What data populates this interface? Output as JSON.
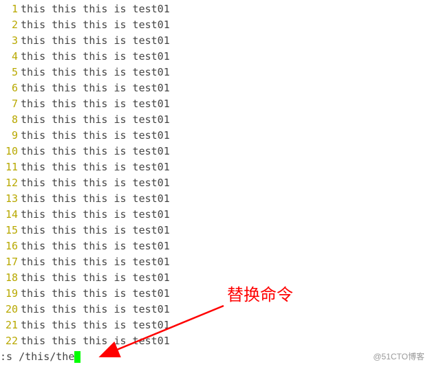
{
  "editor": {
    "lines": [
      {
        "n": "1",
        "t": "this this this is test01"
      },
      {
        "n": "2",
        "t": "this this this is test01"
      },
      {
        "n": "3",
        "t": "this this this is test01"
      },
      {
        "n": "4",
        "t": "this this this is test01"
      },
      {
        "n": "5",
        "t": "this this this is test01"
      },
      {
        "n": "6",
        "t": "this this this is test01"
      },
      {
        "n": "7",
        "t": "this this this is test01"
      },
      {
        "n": "8",
        "t": "this this this is test01"
      },
      {
        "n": "9",
        "t": "this this this is test01"
      },
      {
        "n": "10",
        "t": "this this this is test01"
      },
      {
        "n": "11",
        "t": "this this this is test01"
      },
      {
        "n": "12",
        "t": "this this this is test01"
      },
      {
        "n": "13",
        "t": "this this this is test01"
      },
      {
        "n": "14",
        "t": "this this this is test01"
      },
      {
        "n": "15",
        "t": "this this this is test01"
      },
      {
        "n": "16",
        "t": "this this this is test01"
      },
      {
        "n": "17",
        "t": "this this this is test01"
      },
      {
        "n": "18",
        "t": "this this this is test01"
      },
      {
        "n": "19",
        "t": "this this this is test01"
      },
      {
        "n": "20",
        "t": "this this this is test01"
      },
      {
        "n": "21",
        "t": "this this this is test01"
      },
      {
        "n": "22",
        "t": "this this this is test01"
      }
    ]
  },
  "command": {
    "text": ":s /this/the"
  },
  "annotation": {
    "label": "替换命令"
  },
  "watermark": {
    "text": "@51CTO博客"
  }
}
